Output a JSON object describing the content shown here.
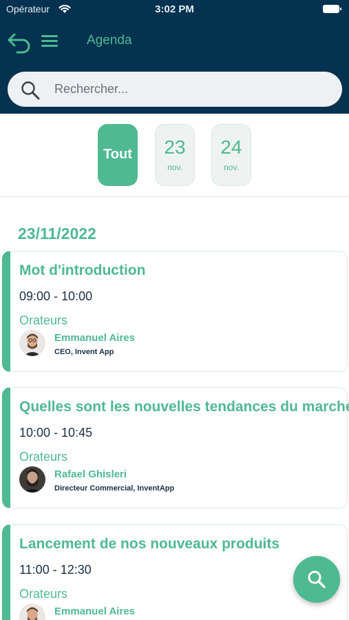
{
  "status_bar": {
    "carrier": "Opérateur",
    "time": "3:02 PM"
  },
  "nav": {
    "title": "Agenda"
  },
  "search": {
    "placeholder": "Rechercher..."
  },
  "date_filter": {
    "all_label": "Tout",
    "days": [
      {
        "day": "23",
        "month": "nov."
      },
      {
        "day": "24",
        "month": "nov."
      }
    ]
  },
  "date_heading": "23/11/2022",
  "sessions": [
    {
      "title": "Mot d'introduction",
      "time": "09:00 - 10:00",
      "speakers_label": "Orateurs",
      "speaker": {
        "name": "Emmanuel Aires",
        "role": "CEO, Invent App"
      }
    },
    {
      "title": "Quelles sont les nouvelles tendances du marché?",
      "time": "10:00 - 10:45",
      "speakers_label": "Orateurs",
      "speaker": {
        "name": "Rafael Ghisleri",
        "role": "Directeur Commercial, InventApp"
      }
    },
    {
      "title": "Lancement de nos nouveaux produits",
      "time": "11:00 - 12:30",
      "speakers_label": "Orateurs",
      "speaker": {
        "name": "Emmanuel Aires",
        "role": "CEO, Invent App"
      }
    }
  ],
  "icons": {
    "back": "back-arrow-icon",
    "menu": "hamburger-menu-icon",
    "search": "search-icon",
    "fab": "search-icon"
  },
  "colors": {
    "header": "#04324f",
    "accent": "#4fb991",
    "text_dark": "#1b2f43"
  }
}
